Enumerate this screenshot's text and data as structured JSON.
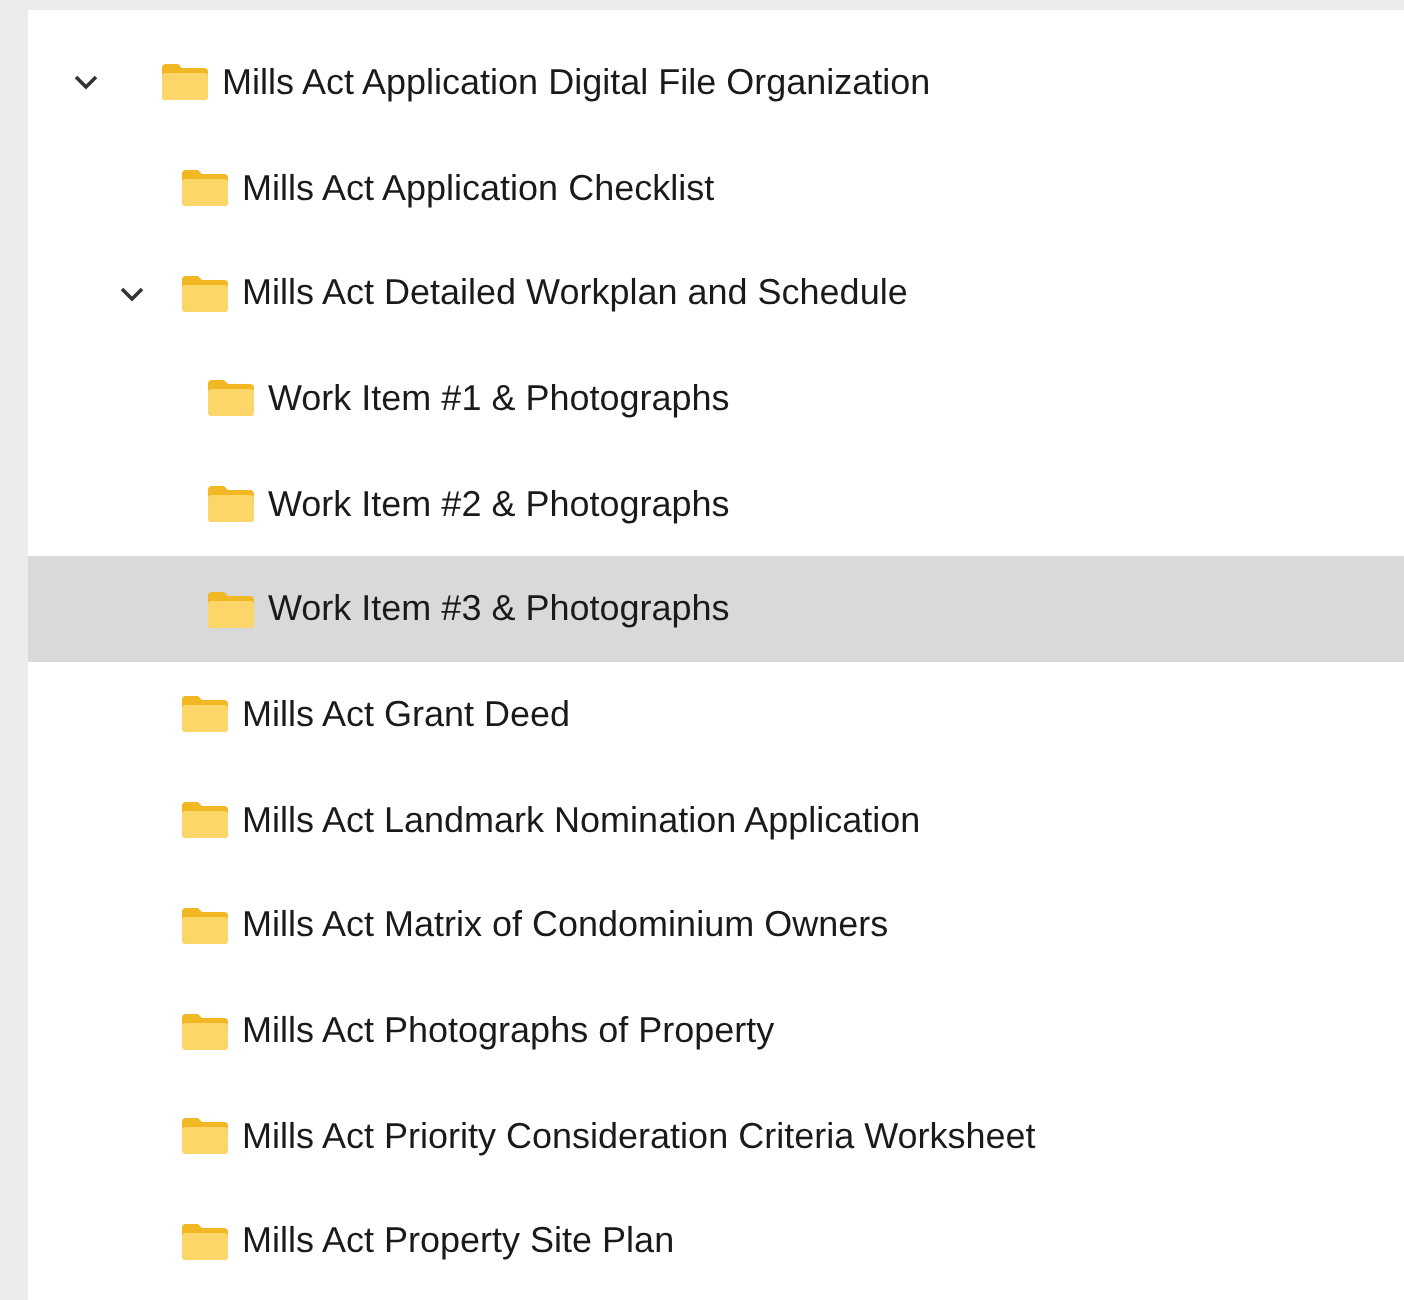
{
  "tree": [
    {
      "label": "Mills Act Application Digital File Organization",
      "selected": false,
      "expanded": true,
      "children": [
        {
          "label": "Mills Act Application Checklist",
          "selected": false
        },
        {
          "label": "Mills Act Detailed Workplan and Schedule",
          "selected": false,
          "expanded": true,
          "children": [
            {
              "label": "Work Item #1 & Photographs",
              "selected": false
            },
            {
              "label": "Work Item #2 & Photographs",
              "selected": false
            },
            {
              "label": "Work Item #3 & Photographs",
              "selected": true
            }
          ]
        },
        {
          "label": "Mills Act Grant Deed",
          "selected": false
        },
        {
          "label": "Mills Act Landmark Nomination Application",
          "selected": false
        },
        {
          "label": "Mills Act Matrix of Condominium Owners",
          "selected": false
        },
        {
          "label": "Mills Act Photographs of Property",
          "selected": false
        },
        {
          "label": "Mills Act Priority Consideration Criteria Worksheet",
          "selected": false
        },
        {
          "label": "Mills Act Property Site Plan",
          "selected": false
        }
      ]
    }
  ]
}
